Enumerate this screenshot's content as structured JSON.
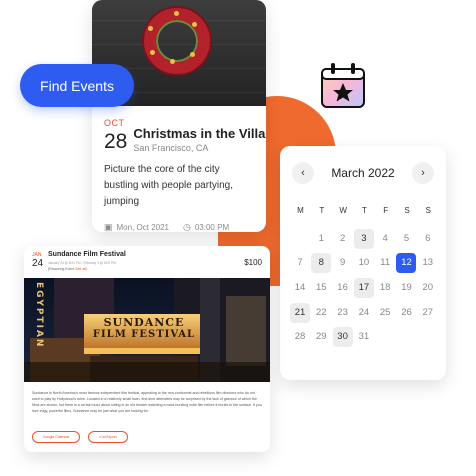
{
  "find_events_button": "Find Events",
  "event": {
    "month": "OCT",
    "day": "28",
    "title": "Christmas in the Villa...",
    "location": "San Francisco, CA",
    "description": "Picture the core of the city bustling with people partying, jumping",
    "date_text": "Mon, Oct 2021",
    "time_text": "03:00 PM"
  },
  "calendar": {
    "month_label": "March 2022",
    "weekdays": [
      "M",
      "T",
      "W",
      "T",
      "F",
      "S",
      "S"
    ],
    "days": [
      [
        null,
        1,
        2,
        3,
        4,
        5,
        6
      ],
      [
        7,
        8,
        9,
        10,
        11,
        12,
        13
      ],
      [
        14,
        15,
        16,
        17,
        18,
        19,
        20
      ],
      [
        21,
        22,
        23,
        24,
        25,
        26,
        27
      ],
      [
        28,
        29,
        30,
        31,
        null,
        null,
        null
      ]
    ],
    "selected_day": 12,
    "highlighted_days": [
      3,
      8,
      17,
      21,
      30
    ],
    "accent_color": "#2e5bf0"
  },
  "film_event": {
    "month": "JAN",
    "day": "24",
    "title": "Sundance Film Festival",
    "date_line": "January 24 @ 8:00 PM - February 3 @ 8:00 PM",
    "recurring_label": "(Recurring Event",
    "recurring_link": "See all)",
    "price": "$100",
    "marquee_top": "SUNDANCE",
    "marquee_bottom": "FILM FESTIVAL",
    "sign_text": "EGYPTIAN",
    "description": "Sundance is North America's most famous independent film festival, appealing to the non-conformist and rebellious film directors who do not want to play by Hollywood's rules. Located in a relatively small town, first-time attendees may be surprised by the lack of glamour of which the films are shown, but there is a certain buzz about sitting in an old theater watching a mold-bursting indie film before it bursts to the surface. If you love edgy, powerful films, Sundance may be just what you are looking for.",
    "button_calendar": "Google Calendar",
    "button_ical": "iCal Export"
  },
  "colors": {
    "brand_blue": "#2e5bf0",
    "orange": "#ef6a2e",
    "date_red": "#ef4d2a"
  }
}
